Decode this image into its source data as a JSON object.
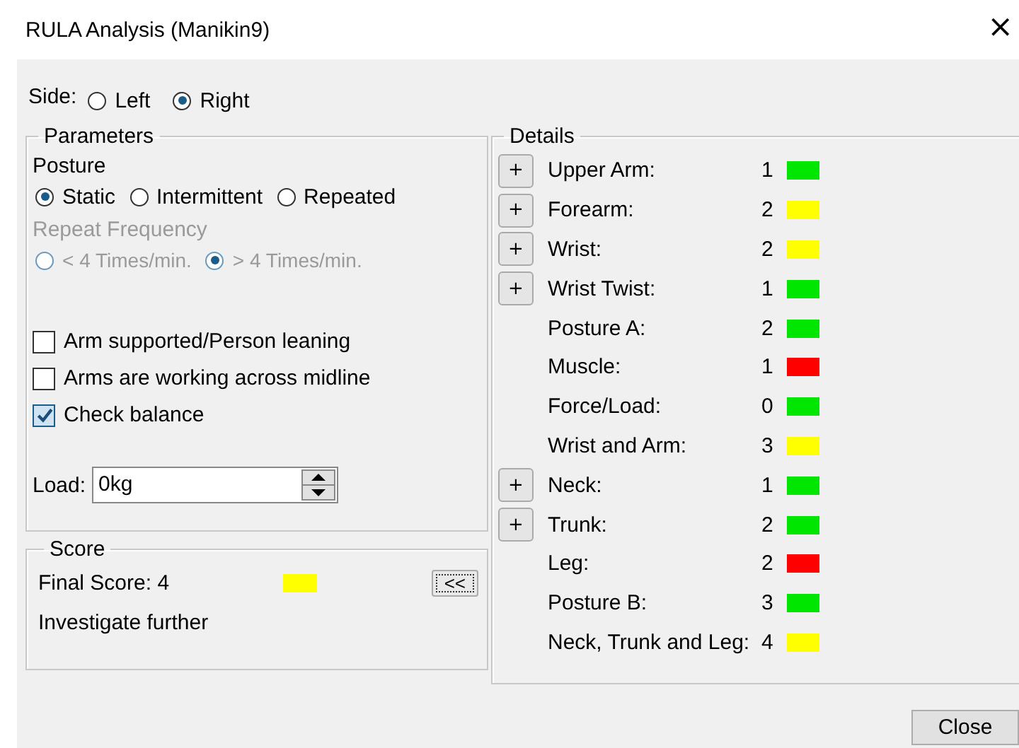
{
  "window": {
    "title": "RULA Analysis (Manikin9)",
    "close": "×"
  },
  "side": {
    "label": "Side:",
    "options": [
      {
        "label": "Left",
        "selected": false
      },
      {
        "label": "Right",
        "selected": true
      }
    ]
  },
  "parameters": {
    "title": "Parameters",
    "posture": {
      "label": "Posture",
      "options": [
        {
          "label": "Static",
          "selected": true
        },
        {
          "label": "Intermittent",
          "selected": false
        },
        {
          "label": "Repeated",
          "selected": false
        }
      ]
    },
    "repeat_frequency": {
      "label": "Repeat Frequency",
      "disabled": true,
      "options": [
        {
          "label": "< 4 Times/min.",
          "selected": false
        },
        {
          "label": "> 4 Times/min.",
          "selected": true
        }
      ]
    },
    "checkboxes": [
      {
        "label": "Arm supported/Person leaning",
        "checked": false
      },
      {
        "label": "Arms are working across midline",
        "checked": false
      },
      {
        "label": "Check balance",
        "checked": true
      }
    ],
    "load": {
      "label": "Load:",
      "value": "0kg"
    }
  },
  "score": {
    "title": "Score",
    "final": "Final Score: 4",
    "color": "#ffff00",
    "verdict": "Investigate further",
    "toggle": "<<"
  },
  "details": {
    "title": "Details",
    "rows": [
      {
        "label": "Upper Arm:",
        "value": "1",
        "color": "#00e600",
        "expandable": true
      },
      {
        "label": "Forearm:",
        "value": "2",
        "color": "#ffff00",
        "expandable": true
      },
      {
        "label": "Wrist:",
        "value": "2",
        "color": "#ffff00",
        "expandable": true
      },
      {
        "label": "Wrist Twist:",
        "value": "1",
        "color": "#00e600",
        "expandable": true
      },
      {
        "label": "Posture A:",
        "value": "2",
        "color": "#00e600",
        "expandable": false
      },
      {
        "label": "Muscle:",
        "value": "1",
        "color": "#ff0000",
        "expandable": false
      },
      {
        "label": "Force/Load:",
        "value": "0",
        "color": "#00e600",
        "expandable": false
      },
      {
        "label": "Wrist and Arm:",
        "value": "3",
        "color": "#ffff00",
        "expandable": false
      },
      {
        "label": "Neck:",
        "value": "1",
        "color": "#00e600",
        "expandable": true
      },
      {
        "label": "Trunk:",
        "value": "2",
        "color": "#00e600",
        "expandable": true
      },
      {
        "label": "Leg:",
        "value": "2",
        "color": "#ff0000",
        "expandable": false
      },
      {
        "label": "Posture B:",
        "value": "3",
        "color": "#00e600",
        "expandable": false
      },
      {
        "label": "Neck, Trunk and Leg:",
        "value": "4",
        "color": "#ffff00",
        "expandable": false
      }
    ],
    "expand_symbol": "+"
  },
  "buttons": [
    "Close"
  ]
}
